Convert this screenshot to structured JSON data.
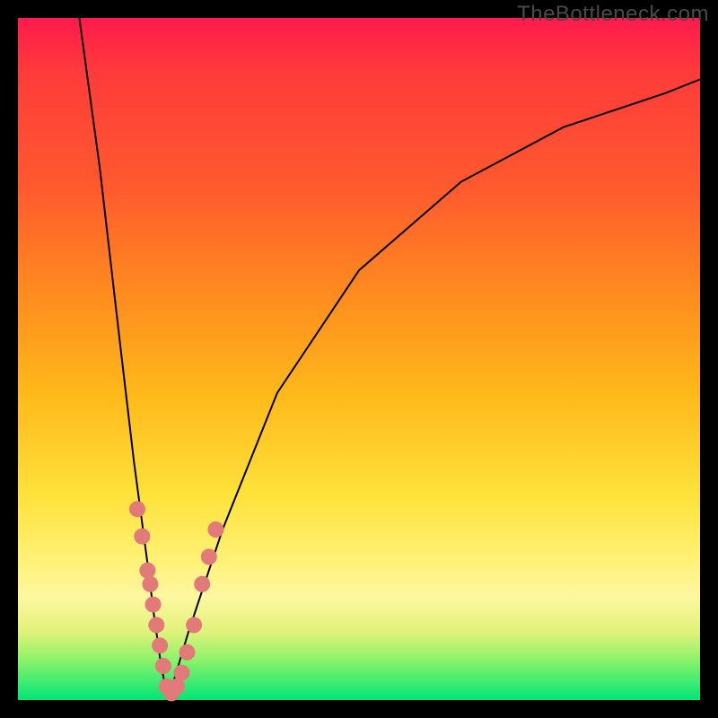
{
  "watermark": "TheBottleneck.com",
  "chart_data": {
    "type": "line",
    "title": "",
    "xlabel": "",
    "ylabel": "",
    "xlim": [
      0,
      100
    ],
    "ylim": [
      0,
      100
    ],
    "grid": false,
    "legend": false,
    "description": "V-shaped bottleneck curve over red-yellow-green gradient; minimum near x≈22 at y≈0, rising steeply left and gently right.",
    "series": [
      {
        "name": "left-branch",
        "x": [
          9,
          12,
          15,
          17,
          19,
          20,
          21,
          22
        ],
        "y": [
          100,
          78,
          52,
          35,
          20,
          12,
          5,
          0
        ]
      },
      {
        "name": "right-branch",
        "x": [
          22,
          25,
          30,
          38,
          50,
          65,
          80,
          95,
          100
        ],
        "y": [
          0,
          10,
          25,
          45,
          63,
          76,
          84,
          89,
          91
        ]
      }
    ],
    "points": {
      "name": "data-dots",
      "comment": "salmon markers clustered around the notch",
      "x": [
        17.5,
        18.2,
        19.0,
        19.4,
        19.8,
        20.3,
        20.8,
        21.3,
        21.8,
        22.5,
        23.3,
        24.0,
        24.8,
        25.8,
        27.0,
        28.0,
        29.0
      ],
      "y": [
        28,
        24,
        19,
        17,
        14,
        11,
        8,
        5,
        2,
        1,
        2,
        4,
        7,
        11,
        17,
        21,
        25
      ]
    },
    "gradient_bands": [
      {
        "label": "red",
        "y_from": 100,
        "y_to": 70
      },
      {
        "label": "orange",
        "y_from": 70,
        "y_to": 40
      },
      {
        "label": "yellow",
        "y_from": 40,
        "y_to": 15
      },
      {
        "label": "lime",
        "y_from": 15,
        "y_to": 6
      },
      {
        "label": "green",
        "y_from": 6,
        "y_to": 0
      }
    ]
  }
}
